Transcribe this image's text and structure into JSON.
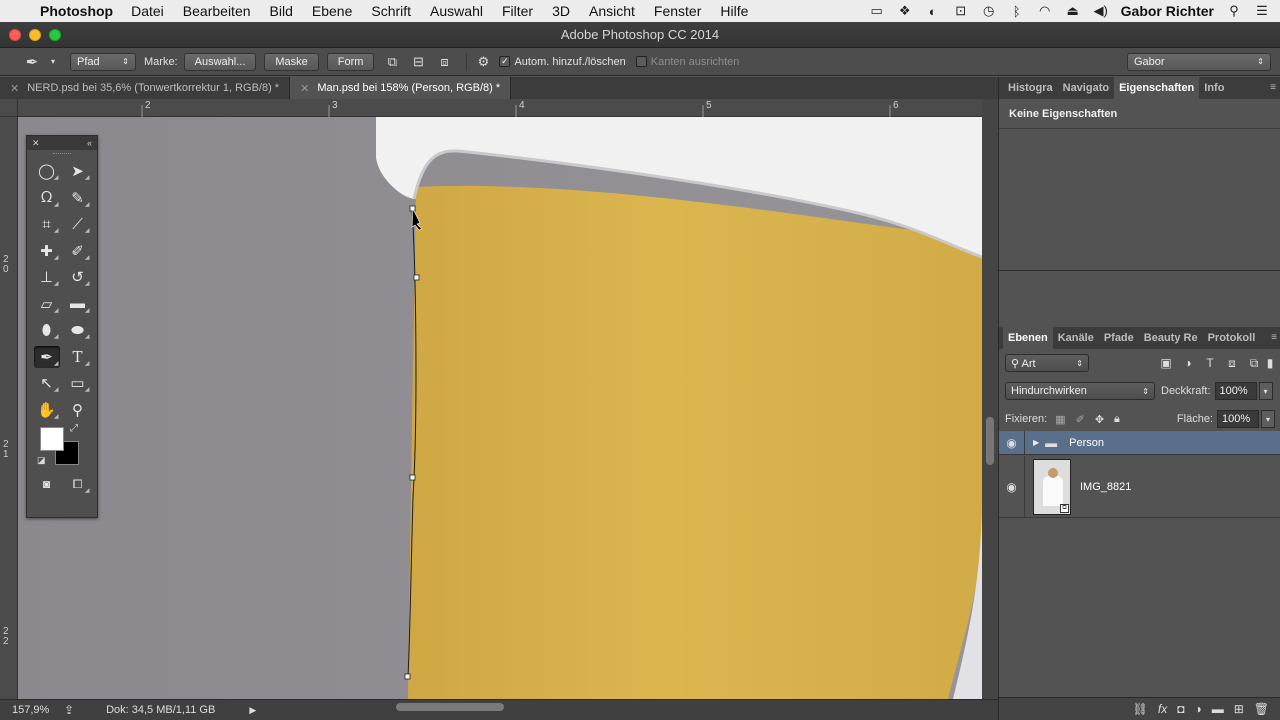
{
  "menubar": {
    "app_name": "Photoshop",
    "items": [
      "Datei",
      "Bearbeiten",
      "Bild",
      "Ebene",
      "Schrift",
      "Auswahl",
      "Filter",
      "3D",
      "Ansicht",
      "Fenster",
      "Hilfe"
    ],
    "user": "Gabor Richter"
  },
  "window": {
    "title": "Adobe Photoshop CC 2014"
  },
  "options_bar": {
    "mode_select": "Pfad",
    "marke_label": "Marke:",
    "btn_selection": "Auswahl...",
    "btn_mask": "Maske",
    "btn_shape": "Form",
    "auto_add_delete": "Autom. hinzuf./löschen",
    "align_edges": "Kanten ausrichten",
    "workspace": "Gabor"
  },
  "doc_tabs": [
    {
      "label": "NERD.psd bei 35,6% (Tonwertkorrektur 1, RGB/8) *",
      "active": false
    },
    {
      "label": "Man.psd bei 158% (Person, RGB/8) *",
      "active": true
    }
  ],
  "ruler": {
    "top_ticks": [
      "2",
      "3",
      "4",
      "5",
      "6"
    ],
    "left_ticks": [
      "2\n0",
      "2\n1",
      "2\n2"
    ]
  },
  "status": {
    "zoom": "157,9%",
    "doc_info": "Dok: 34,5 MB/1,11 GB"
  },
  "panels": {
    "top_tabs": [
      "Histogra",
      "Navigato",
      "Eigenschaften",
      "Info"
    ],
    "active_top_tab": "Eigenschaften",
    "properties_empty": "Keine Eigenschaften",
    "layer_tabs": [
      "Ebenen",
      "Kanäle",
      "Pfade",
      "Beauty Re",
      "Protokoll"
    ],
    "filter_kind": "Art",
    "blend_mode": "Hindurchwirken",
    "opacity_label": "Deckkraft:",
    "opacity_value": "100%",
    "lock_label": "Fixieren:",
    "fill_label": "Fläche:",
    "fill_value": "100%",
    "layers": [
      {
        "name": "Person",
        "type": "group",
        "selected": true
      },
      {
        "name": "IMG_8821",
        "type": "smart-object",
        "selected": false
      }
    ]
  },
  "colors": {
    "accent_selected_layer": "#5a6f8c",
    "skin": "#d8b24a",
    "background_gray": "#8e8c8f"
  }
}
